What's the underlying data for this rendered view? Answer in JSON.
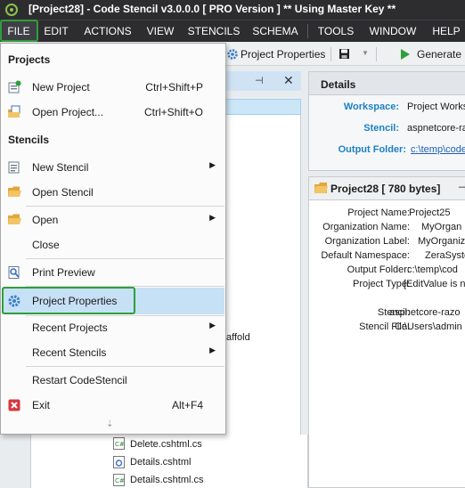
{
  "window": {
    "title": "[Project28] - Code Stencil v3.0.0.0 [ PRO Version ]  ** Using Master Key **"
  },
  "menubar": {
    "items": [
      "FILE",
      "EDIT",
      "ACTIONS",
      "VIEW",
      "STENCILS",
      "SCHEMA",
      "TOOLS",
      "WINDOW",
      "HELP"
    ],
    "active": "FILE"
  },
  "toolbar": {
    "project_properties": "Project Properties",
    "generate": "Generate"
  },
  "file_menu": {
    "sections": {
      "projects": "Projects",
      "stencils": "Stencils"
    },
    "items": {
      "new_project": {
        "label": "New Project",
        "shortcut": "Ctrl+Shift+P",
        "icon": "new-project-icon"
      },
      "open_project": {
        "label": "Open Project...",
        "shortcut": "Ctrl+Shift+O",
        "icon": "open-project-icon"
      },
      "new_stencil": {
        "label": "New Stencil",
        "icon": "new-stencil-icon"
      },
      "open_stencil": {
        "label": "Open Stencil",
        "icon": "folder-open-icon"
      },
      "open": {
        "label": "Open",
        "icon": "folder-icon"
      },
      "close": {
        "label": "Close"
      },
      "print_preview": {
        "label": "Print Preview",
        "icon": "print-preview-icon"
      },
      "project_properties": {
        "label": "Project Properties",
        "icon": "gear-icon"
      },
      "recent_projects": {
        "label": "Recent Projects"
      },
      "recent_stencils": {
        "label": "Recent Stencils"
      },
      "restart": {
        "label": "Restart CodeStencil"
      },
      "exit": {
        "label": "Exit",
        "shortcut": "Alt+F4",
        "icon": "exit-icon"
      }
    },
    "more_glyph": "⇣"
  },
  "details": {
    "title": "Details",
    "workspace_label": "Workspace:",
    "workspace_value": "Project Works",
    "stencil_label": "Stencil:",
    "stencil_value": "aspnetcore-raz",
    "output_label": "Output Folder:",
    "output_value": "c:\\temp\\code"
  },
  "project_panel": {
    "title": "Project28 [ 780 bytes]",
    "rows": [
      {
        "label": "Project Name:",
        "value": "Project25"
      },
      {
        "label": "Organization Name:",
        "value": "MyOrgan"
      },
      {
        "label": "Organization Label:",
        "value": "MyOrganiz"
      },
      {
        "label": "Default Namespace:",
        "value": "ZeraSyste"
      },
      {
        "label": "Output Folder:",
        "value": "c:\\temp\\cod"
      },
      {
        "label": "Project Type:",
        "value": "[EditValue is n"
      },
      {
        "label": "Stencil:",
        "value": "aspnetcore-razo"
      },
      {
        "label": "Stencil File:",
        "value": "C:\\Users\\admin"
      }
    ]
  },
  "tree": {
    "partial_label": "affold",
    "files": [
      "Delete.cshtml.cs",
      "Details.cshtml",
      "Details.cshtml.cs"
    ]
  },
  "colors": {
    "titlebar": "#2d2d30",
    "highlight_outline": "#2e9f3a",
    "selection": "#c6e0f5",
    "accent_blue": "#1f80c4"
  }
}
